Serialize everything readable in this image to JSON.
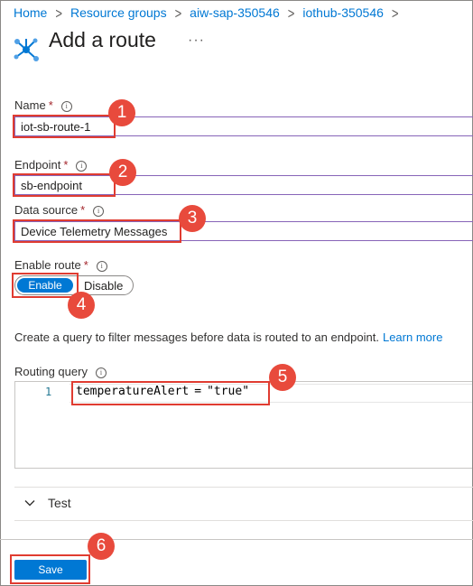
{
  "breadcrumb": [
    {
      "label": "Home"
    },
    {
      "label": "Resource groups"
    },
    {
      "label": "aiw-sap-350546"
    },
    {
      "label": "iothub-350546"
    }
  ],
  "header": {
    "title": "Add a route",
    "more": "···"
  },
  "form": {
    "name": {
      "label": "Name",
      "required": "*",
      "value": "iot-sb-route-1"
    },
    "endpoint": {
      "label": "Endpoint",
      "required": "*",
      "value": "sb-endpoint"
    },
    "data_source": {
      "label": "Data source",
      "required": "*",
      "value": "Device Telemetry Messages"
    },
    "enable_route": {
      "label": "Enable route",
      "required": "*",
      "on_label": "Enable",
      "off_label": "Disable",
      "selected": "Enable"
    },
    "query_description": "Create a query to filter messages before data is routed to an endpoint.",
    "learn_more": "Learn more",
    "routing_query": {
      "label": "Routing query",
      "line_number": "1",
      "code_left": "temperatureAlert",
      "code_op": "=",
      "code_right": "\"true\""
    },
    "test_label": "Test"
  },
  "footer": {
    "save_label": "Save"
  },
  "annotations": [
    "1",
    "2",
    "3",
    "4",
    "5",
    "6"
  ],
  "colors": {
    "accent": "#0078d4",
    "annotation": "#e03c31",
    "input_border": "#8764b8"
  },
  "icons": {
    "route": "route-icon",
    "info": "info-icon",
    "chevron": "chevron-down-icon"
  }
}
